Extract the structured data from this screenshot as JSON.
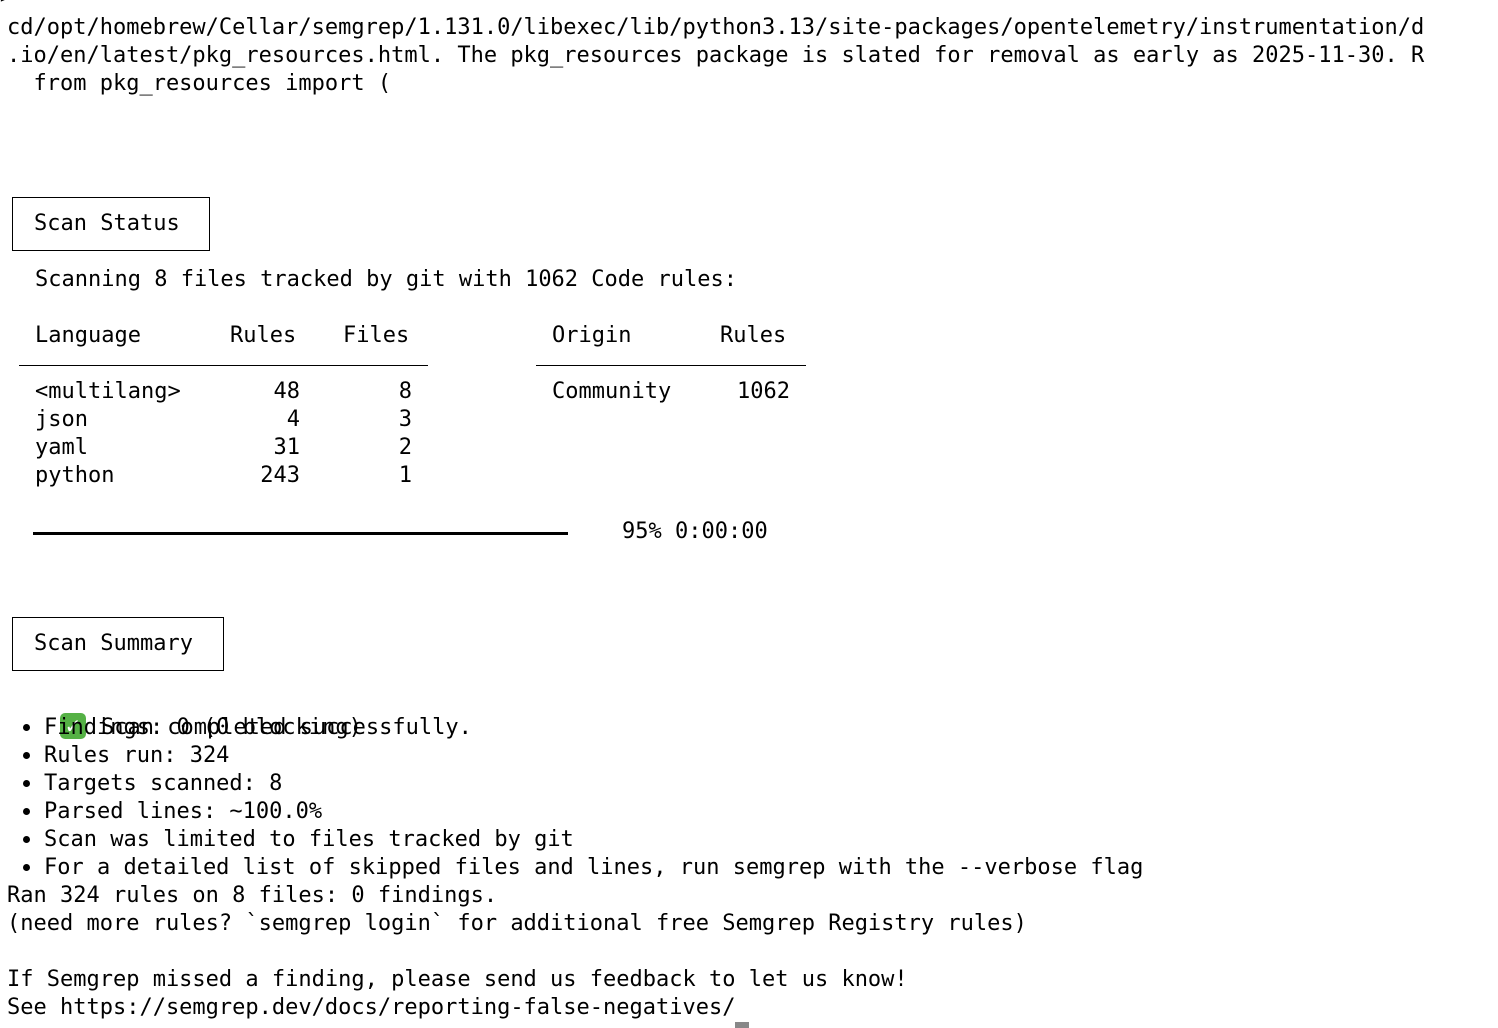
{
  "terminal": {
    "prompt_fragment": ">",
    "warning_lines": [
      "cd/opt/homebrew/Cellar/semgrep/1.131.0/libexec/lib/python3.13/site-packages/opentelemetry/instrumentation/d",
      ".io/en/latest/pkg_resources.html. The pkg_resources package is slated for removal as early as 2025-11-30. R",
      "  from pkg_resources import ("
    ],
    "scan_status": {
      "title": "Scan Status",
      "intro": "Scanning 8 files tracked by git with 1062 Code rules:",
      "language_table": {
        "headers": [
          "Language",
          "Rules",
          "Files"
        ],
        "rows": [
          [
            "<multilang>",
            "48",
            "8"
          ],
          [
            "json",
            "4",
            "3"
          ],
          [
            "yaml",
            "31",
            "2"
          ],
          [
            "python",
            "243",
            "1"
          ]
        ]
      },
      "origin_table": {
        "headers": [
          "Origin",
          "Rules"
        ],
        "rows": [
          [
            "Community",
            "1062"
          ]
        ]
      },
      "progress": {
        "fraction": 0.95,
        "text": "95% 0:00:00"
      }
    },
    "scan_summary": {
      "title": "Scan Summary",
      "success_icon": "check-mark-icon",
      "success_text": "Scan completed successfully.",
      "bullets": [
        "Findings: 0 (0 blocking)",
        "Rules run: 324",
        "Targets scanned: 8",
        "Parsed lines: ~100.0%",
        "Scan was limited to files tracked by git",
        "For a detailed list of skipped files and lines, run semgrep with the --verbose flag"
      ],
      "result_line": "Ran 324 rules on 8 files: 0 findings.",
      "login_hint": "(need more rules? `semgrep login` for additional free Semgrep Registry rules)",
      "feedback_line": "If Semgrep missed a finding, please send us feedback to let us know!",
      "see_line": "See https://semgrep.dev/docs/reporting-false-negatives/"
    },
    "colors": {
      "background": "#ffffff",
      "text": "#000000",
      "success_icon": "#55b145"
    }
  }
}
